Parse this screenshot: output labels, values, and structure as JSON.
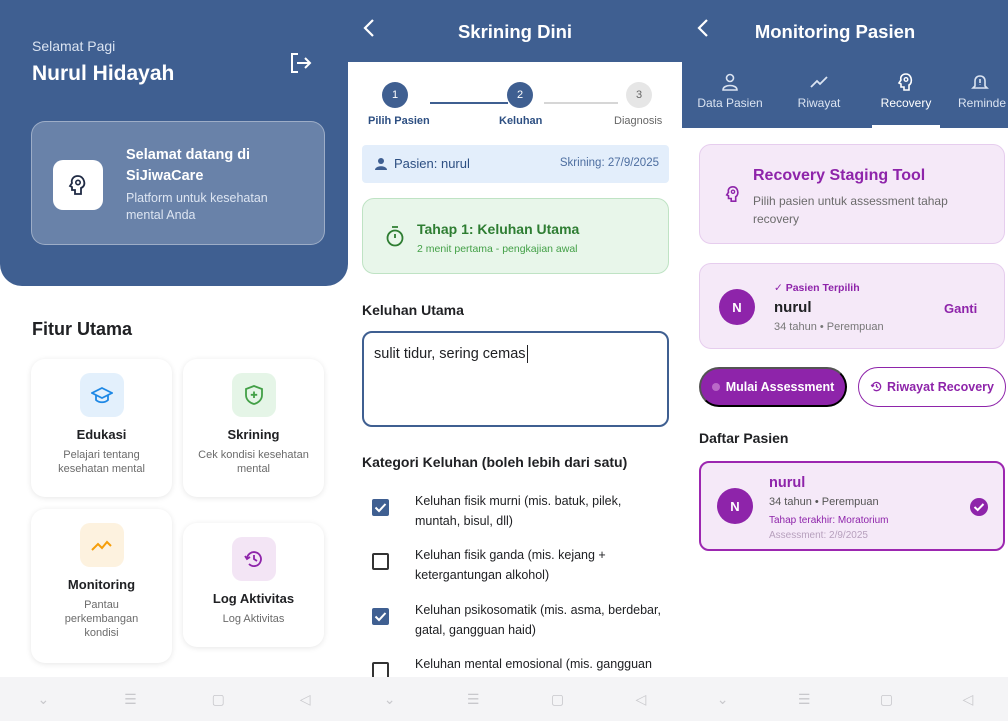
{
  "home": {
    "greeting": "Selamat Pagi",
    "user_name": "Nurul Hidayah",
    "welcome_title": "Selamat datang di SiJiwaCare",
    "welcome_sub": "Platform untuk kesehatan mental Anda",
    "features_title": "Fitur Utama",
    "features": [
      {
        "label": "Edukasi",
        "desc": "Pelajari tentang kesehatan mental",
        "icon": "graduation-cap-icon",
        "color": "#1e88e5",
        "bg": "#e3f0fc"
      },
      {
        "label": "Skrining",
        "desc": "Cek kondisi kesehatan mental",
        "icon": "shield-plus-icon",
        "color": "#43a047",
        "bg": "#e5f5e7"
      },
      {
        "label": "Monitoring",
        "desc": "Pantau perkembangan kondisi",
        "icon": "trend-line-icon",
        "color": "#f59e0b",
        "bg": "#fdf2df"
      },
      {
        "label": "Log Aktivitas",
        "desc": "Log Aktivitas",
        "icon": "history-icon",
        "color": "#8e24aa",
        "bg": "#f3e5f5"
      }
    ]
  },
  "screening": {
    "title": "Skrining Dini",
    "steps": [
      {
        "num": "1",
        "label": "Pilih Pasien",
        "state": "done"
      },
      {
        "num": "2",
        "label": "Keluhan",
        "state": "active"
      },
      {
        "num": "3",
        "label": "Diagnosis",
        "state": "pending"
      }
    ],
    "patient_label": "Pasien: nurul",
    "screening_date": "Skrining: 27/9/2025",
    "stage_title": "Tahap 1: Keluhan Utama",
    "stage_sub": "2 menit pertama - pengkajian awal",
    "complaint_label": "Keluhan Utama",
    "complaint_value": "sulit tidur, sering cemas",
    "category_label": "Kategori Keluhan (boleh lebih dari satu)",
    "categories": [
      {
        "text": "Keluhan fisik murni (mis. batuk, pilek, muntah, bisul, dll)",
        "checked": true
      },
      {
        "text": "Keluhan fisik ganda (mis. kejang + ketergantungan alkohol)",
        "checked": false
      },
      {
        "text": "Keluhan psikosomatik (mis. asma, berdebar, gatal, gangguan haid)",
        "checked": true
      },
      {
        "text": "Keluhan mental emosional (mis. gangguan perilaku, perasaan)",
        "checked": false
      }
    ]
  },
  "monitoring": {
    "title": "Monitoring Pasien",
    "tabs": [
      {
        "label": "Data Pasien",
        "icon": "person-icon"
      },
      {
        "label": "Riwayat",
        "icon": "trend-line-icon"
      },
      {
        "label": "Recovery",
        "icon": "brain-icon",
        "active": true
      },
      {
        "label": "Reminde",
        "icon": "bell-icon"
      }
    ],
    "tool_title": "Recovery Staging Tool",
    "tool_sub": "Pilih pasien untuk assessment tahap recovery",
    "selected_label": "✓ Pasien Terpilih",
    "selected_name": "nurul",
    "selected_meta": "34 tahun • Perempuan",
    "change_label": "Ganti",
    "avatar_initial": "N",
    "start_button": "Mulai Assessment",
    "history_button": "Riwayat Recovery",
    "list_title": "Daftar Pasien",
    "patient_name": "nurul",
    "patient_meta": "34 tahun • Perempuan",
    "patient_stage": "Tahap terakhir: Moratorium",
    "patient_assessment": "Assessment: 2/9/2025"
  },
  "colors": {
    "primary": "#3f5f91",
    "purple": "#8e24aa",
    "green": "#2e7d32"
  }
}
